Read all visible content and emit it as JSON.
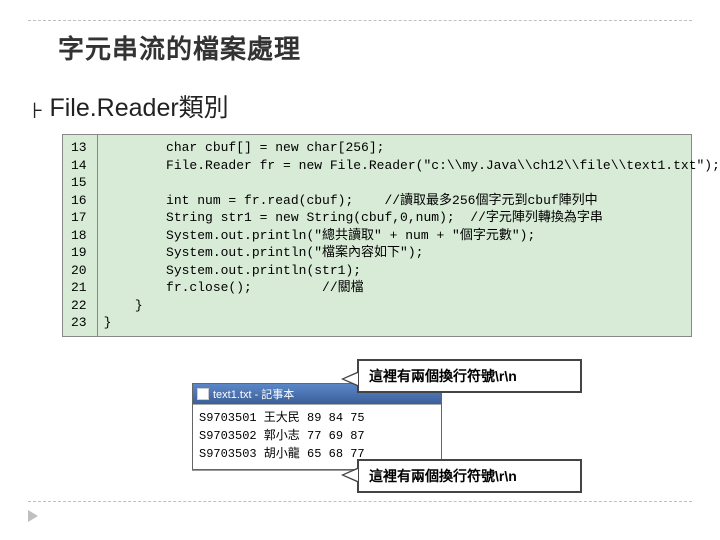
{
  "title": "字元串流的檔案處理",
  "section_title": "File.Reader類別",
  "code": {
    "line_numbers": [
      "13",
      "14",
      "15",
      "16",
      "17",
      "18",
      "19",
      "20",
      "21",
      "22",
      "23"
    ],
    "lines": [
      "        char cbuf[] = new char[256];",
      "        File.Reader fr = new File.Reader(\"c:\\\\my.Java\\\\ch12\\\\file\\\\text1.txt\");",
      "",
      "        int num = fr.read(cbuf);    //讀取最多256個字元到cbuf陣列中",
      "        String str1 = new String(cbuf,0,num);  //字元陣列轉換為字串",
      "        System.out.println(\"總共讀取\" + num + \"個字元數\");",
      "        System.out.println(\"檔案內容如下\");",
      "        System.out.println(str1);",
      "        fr.close();         //關檔",
      "    }",
      "}"
    ]
  },
  "notepad": {
    "title": "text1.txt - 記事本",
    "rows": [
      "S9703501 王大民 89 84 75",
      "S9703502 郭小志 77 69 87",
      "S9703503 胡小龍 65 68 77"
    ]
  },
  "callouts": {
    "c1": "這裡有兩個換行符號\\r\\n",
    "c2": "這裡有兩個換行符號\\r\\n"
  }
}
